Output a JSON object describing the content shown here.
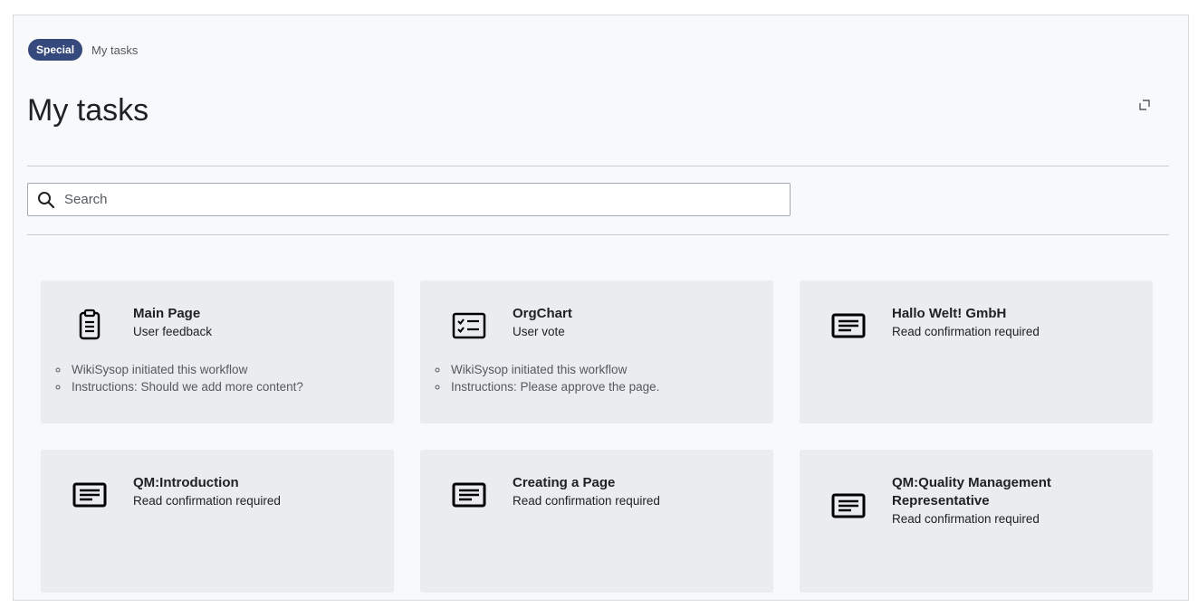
{
  "breadcrumb": {
    "badge": "Special",
    "current": "My tasks"
  },
  "page_title": "My tasks",
  "search": {
    "placeholder": "Search",
    "value": ""
  },
  "cards": [
    {
      "title": "Main Page",
      "subtitle": "User feedback",
      "icon": "clipboard-icon",
      "details": [
        "WikiSysop initiated this workflow",
        "Instructions: Should we add more content?"
      ]
    },
    {
      "title": "OrgChart",
      "subtitle": "User vote",
      "icon": "checklist-icon",
      "details": [
        "WikiSysop initiated this workflow",
        "Instructions: Please approve the page."
      ]
    },
    {
      "title": "Hallo Welt! GmbH",
      "subtitle": "Read confirmation required",
      "icon": "document-icon",
      "details": []
    },
    {
      "title": "QM:Introduction",
      "subtitle": "Read confirmation required",
      "icon": "document-icon",
      "details": []
    },
    {
      "title": "Creating a Page",
      "subtitle": "Read confirmation required",
      "icon": "document-icon",
      "details": []
    },
    {
      "title": "QM:Quality Management Representative",
      "subtitle": "Read confirmation required",
      "icon": "document-icon",
      "details": []
    }
  ],
  "colors": {
    "badge": "#36497c",
    "card": "#eaecf0",
    "panel": "#f8f9fa"
  }
}
